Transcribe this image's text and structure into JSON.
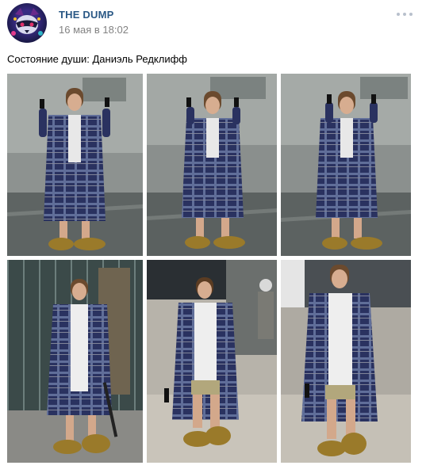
{
  "post": {
    "author": "THE DUMP",
    "date": "16 мая в 18:02",
    "text": "Состояние души: Даниэль Редклифф"
  },
  "photos": [
    {
      "id": 1,
      "scene": "rain",
      "pose": "pistols-up"
    },
    {
      "id": 2,
      "scene": "rain",
      "pose": "pistols-up"
    },
    {
      "id": 3,
      "scene": "rain",
      "pose": "pistols-up"
    },
    {
      "id": 4,
      "scene": "glass",
      "pose": "walking"
    },
    {
      "id": 5,
      "scene": "street",
      "pose": "walking"
    },
    {
      "id": 6,
      "scene": "street",
      "pose": "walking"
    }
  ],
  "icons": {
    "avatar": "raccoon-avatar-icon",
    "menu": "more-dots-icon"
  },
  "colors": {
    "author_link": "#2a5885",
    "date_gray": "#828282",
    "robe_navy": "#28305a",
    "slippers": "#9a7a2a"
  }
}
